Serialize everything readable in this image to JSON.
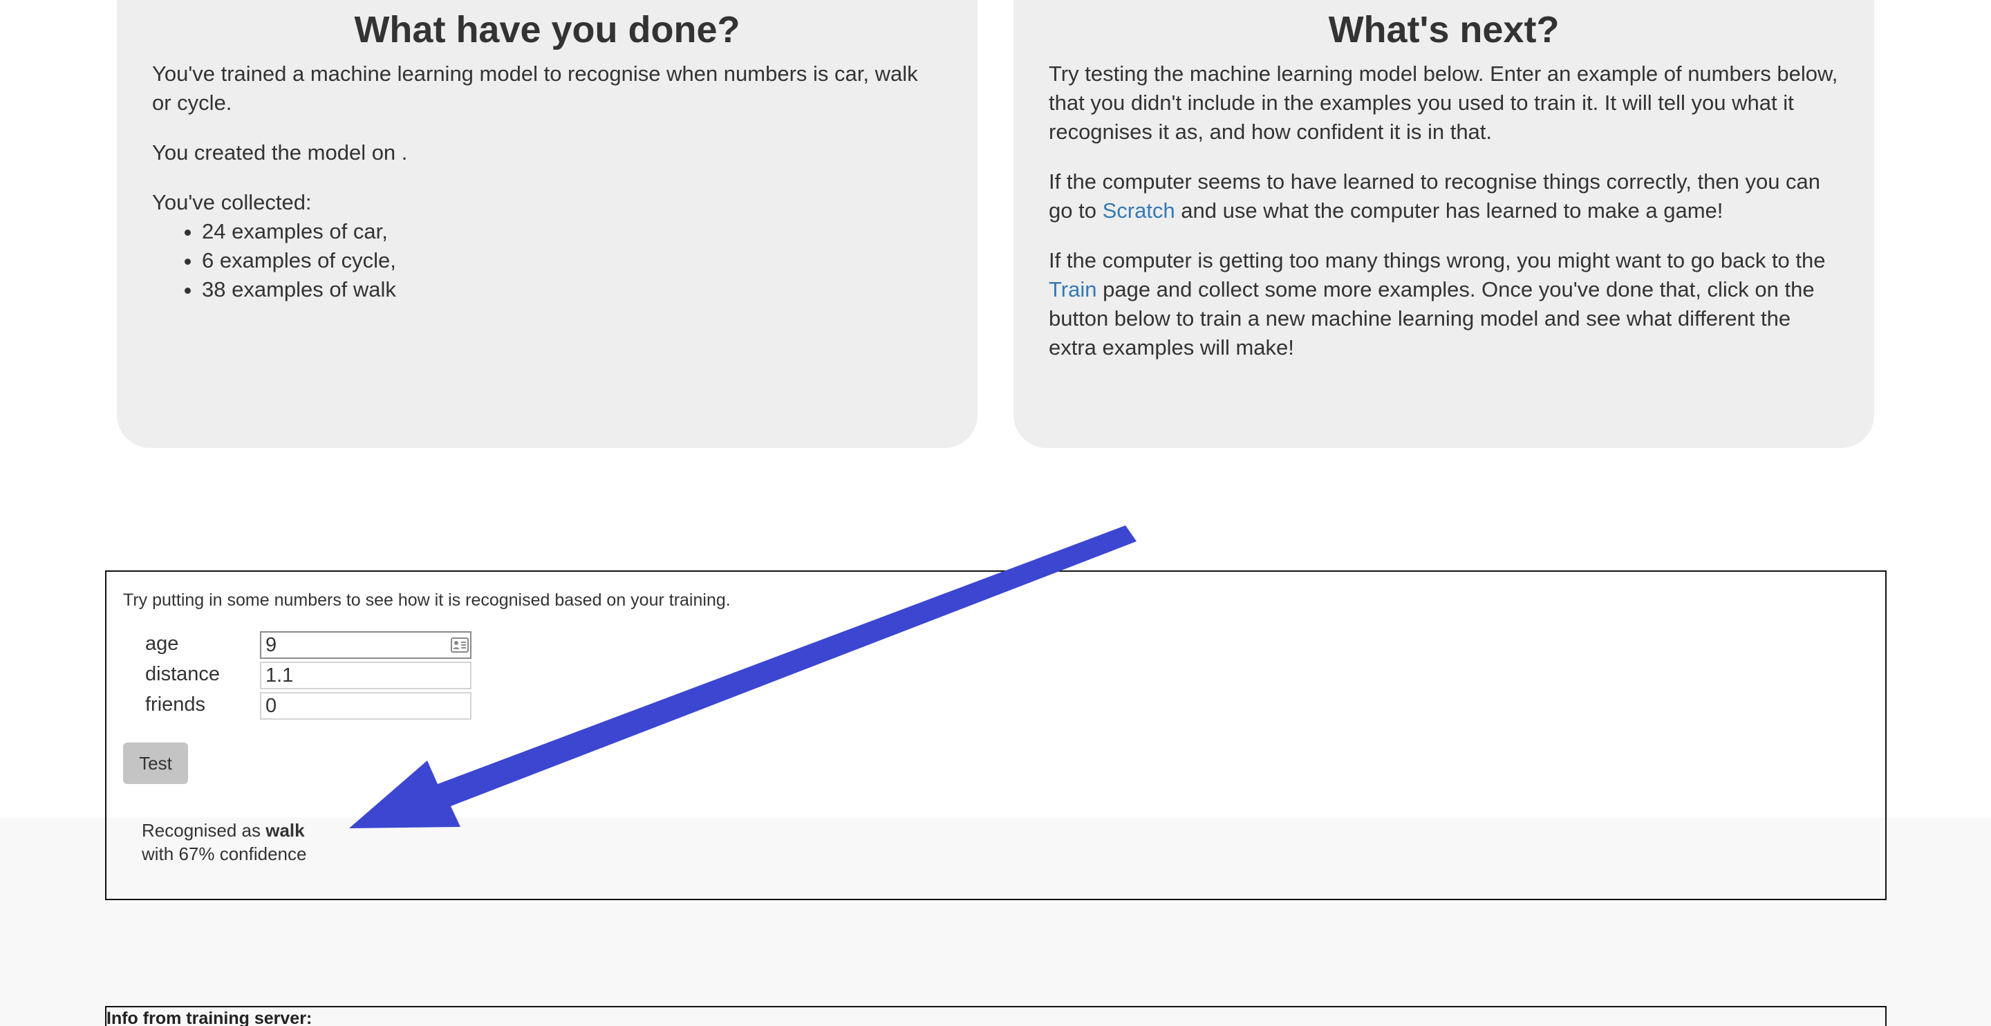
{
  "done_panel": {
    "title": "What have you done?",
    "summary": "You've trained a machine learning model to recognise when numbers is car, walk or cycle.",
    "created": "You created the model on .",
    "collected_label": "You've collected:",
    "collected_items": [
      "24 examples of car,",
      "6 examples of cycle,",
      "38 examples of walk"
    ]
  },
  "next_panel": {
    "title": "What's next?",
    "para1": "Try testing the machine learning model below. Enter an example of numbers below, that you didn't include in the examples you used to train it. It will tell you what it recognises it as, and how confident it is in that.",
    "para2_before": "If the computer seems to have learned to recognise things correctly, then you can go to ",
    "para2_link": "Scratch",
    "para2_after": " and use what the computer has learned to make a game!",
    "para3_before": "If the computer is getting too many things wrong, you might want to go back to the ",
    "para3_link": "Train",
    "para3_after": " page and collect some more examples. Once you've done that, click on the button below to train a new machine learning model and see what different the extra examples will make!"
  },
  "test_panel": {
    "instructions": "Try putting in some numbers to see how it is recognised based on your training.",
    "fields": [
      {
        "label": "age",
        "value": "9"
      },
      {
        "label": "distance",
        "value": "1.1"
      },
      {
        "label": "friends",
        "value": "0"
      }
    ],
    "test_button": "Test",
    "result_prefix": "Recognised as ",
    "result_label": "walk",
    "result_confidence": "with 67% confidence"
  },
  "info_panel": {
    "title": "Info from training server:"
  },
  "colors": {
    "panel_bg": "#eeeeee",
    "link": "#337ab7",
    "arrow": "#3c46d0",
    "button_bg": "#c4c4c4"
  }
}
